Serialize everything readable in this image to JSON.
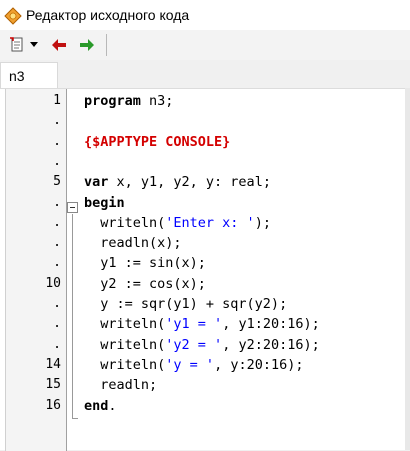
{
  "window": {
    "title": "Редактор исходного кода"
  },
  "toolbar": {
    "items": [
      "new-file-dropdown",
      "back",
      "forward"
    ]
  },
  "tabs": [
    {
      "label": "n3"
    }
  ],
  "gutter": {
    "labels": [
      "1",
      ".",
      ".",
      ".",
      "5",
      ".",
      ".",
      ".",
      ".",
      "10",
      ".",
      ".",
      ".",
      "14",
      "15",
      "16"
    ]
  },
  "code": {
    "lines": [
      [
        [
          "kw",
          "program"
        ],
        [
          "t",
          " n3;"
        ]
      ],
      [],
      [
        [
          "dir",
          "{$APPTYPE CONSOLE}"
        ]
      ],
      [],
      [
        [
          "kw",
          "var"
        ],
        [
          "t",
          " x, y1, y2, y: real;"
        ]
      ],
      [
        [
          "kw",
          "begin"
        ]
      ],
      [
        [
          "t",
          "  writeln("
        ],
        [
          "str",
          "'Enter x: '"
        ],
        [
          "t",
          ");"
        ]
      ],
      [
        [
          "t",
          "  readln(x);"
        ]
      ],
      [
        [
          "t",
          "  y1 := sin(x);"
        ]
      ],
      [
        [
          "t",
          "  y2 := cos(x);"
        ]
      ],
      [
        [
          "t",
          "  y := sqr(y1) + sqr(y2);"
        ]
      ],
      [
        [
          "t",
          "  writeln("
        ],
        [
          "str",
          "'y1 = '"
        ],
        [
          "t",
          ", y1:20:16);"
        ]
      ],
      [
        [
          "t",
          "  writeln("
        ],
        [
          "str",
          "'y2 = '"
        ],
        [
          "t",
          ", y2:20:16);"
        ]
      ],
      [
        [
          "t",
          "  writeln("
        ],
        [
          "str",
          "'y = '"
        ],
        [
          "t",
          ", y:20:16);"
        ]
      ],
      [
        [
          "t",
          "  readln;"
        ]
      ],
      [
        [
          "kw",
          "end"
        ],
        [
          "t",
          "."
        ]
      ]
    ]
  }
}
